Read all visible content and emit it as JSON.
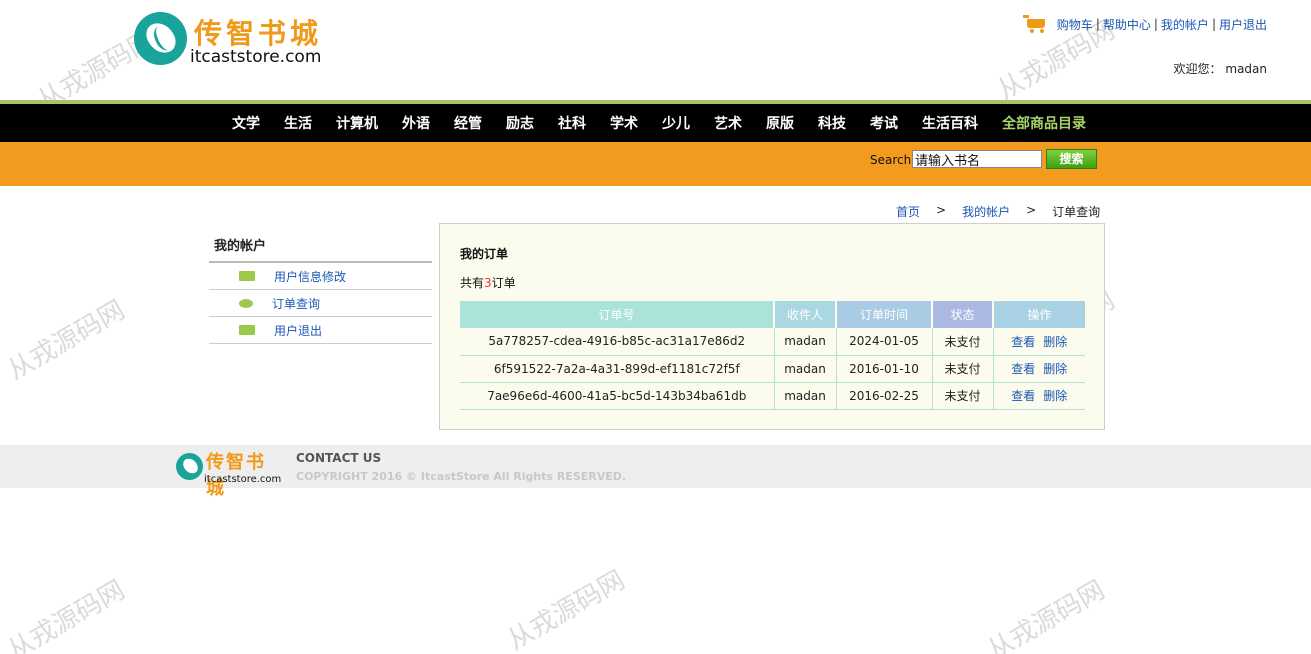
{
  "header": {
    "logo_cn": "传智书城",
    "logo_en": "itcaststore.com",
    "links": [
      "购物车",
      "帮助中心",
      "我的帐户",
      "用户退出"
    ],
    "welcome_label": "欢迎您：",
    "username": "madan"
  },
  "nav": {
    "items": [
      "文学",
      "生活",
      "计算机",
      "外语",
      "经管",
      "励志",
      "社科",
      "学术",
      "少儿",
      "艺术",
      "原版",
      "科技",
      "考试",
      "生活百科",
      "全部商品目录"
    ]
  },
  "search": {
    "label": "Search",
    "value": "请输入书名",
    "button": "搜索"
  },
  "breadcrumb": {
    "home": "首页",
    "account": "我的帐户",
    "current": "订单查询",
    "separator": ">"
  },
  "sidebar": {
    "title": "我的帐户",
    "items": [
      "用户信息修改",
      "订单查询",
      "用户退出"
    ]
  },
  "main": {
    "title": "我的订单",
    "count_prefix": "共有",
    "count": "3",
    "count_suffix": "订单",
    "columns": [
      "订单号",
      "收件人",
      "订单时间",
      "状态",
      "操作"
    ],
    "rows": [
      {
        "id": "5a778257-cdea-4916-b85c-ac31a17e86d2",
        "receiver": "madan",
        "time": "2024-01-05",
        "status": "未支付",
        "view": "查看",
        "delete": "删除"
      },
      {
        "id": "6f591522-7a2a-4a31-899d-ef1181c72f5f",
        "receiver": "madan",
        "time": "2016-01-10",
        "status": "未支付",
        "view": "查看",
        "delete": "删除"
      },
      {
        "id": "7ae96e6d-4600-41a5-bc5d-143b34ba61db",
        "receiver": "madan",
        "time": "2016-02-25",
        "status": "未支付",
        "view": "查看",
        "delete": "删除"
      }
    ]
  },
  "footer": {
    "logo_cn": "传智书城",
    "logo_en": "itcaststore.com",
    "contact": "CONTACT US",
    "copyright": "COPYRIGHT 2016 © ItcastStore All Rights RESERVED."
  },
  "watermark": "从戎源码网"
}
